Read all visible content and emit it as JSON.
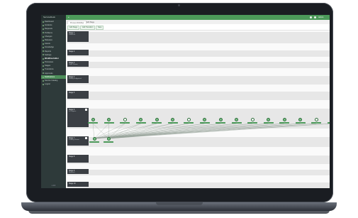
{
  "app": {
    "brand": "ServiceDesk",
    "footer": "v 1.0"
  },
  "sidebar": {
    "items": [
      {
        "label": "Dashboard"
      },
      {
        "label": "Incidents"
      },
      {
        "label": "Requests"
      },
      {
        "label": "Problems"
      },
      {
        "label": "Changes"
      },
      {
        "label": "Releases"
      },
      {
        "label": "Assets"
      },
      {
        "label": "Knowledge"
      },
      {
        "label": "Reports"
      },
      {
        "label": "Settings"
      },
      {
        "label": "Workflow Editor"
      },
      {
        "label": "Processes"
      },
      {
        "label": "Stages"
      },
      {
        "label": "Transitions"
      },
      {
        "label": "Approvals"
      },
      {
        "label": "Notifications"
      },
      {
        "label": "Service Catalog"
      },
      {
        "label": "Logout"
      }
    ],
    "active_index": 15
  },
  "topbar": {
    "left_text": "≡",
    "right_text": "Admin"
  },
  "tabs": [
    {
      "label": "Process Workflow"
    },
    {
      "label": "Edit Stage"
    }
  ],
  "toolbar": {
    "btn1": "Add Stage",
    "btn2": "Add Transition",
    "btn3": "Save"
  },
  "lanes": [
    {
      "title": "Stage 1",
      "sub": "Submitted"
    },
    {
      "title": "Stage 2",
      "sub": ""
    },
    {
      "title": "Stage 3",
      "sub": "Under Review"
    },
    {
      "title": "Stage 4",
      "sub": "Waiting for Approval"
    },
    {
      "title": "Stage 5",
      "sub": ""
    },
    {
      "title": "Stage 6",
      "sub": "In Progress"
    },
    {
      "title": "Stage 7",
      "sub": "Pending Closure"
    },
    {
      "title": "Stage 8",
      "sub": ""
    },
    {
      "title": "Stage 9",
      "sub": "Resolved"
    },
    {
      "title": "Stage 10",
      "sub": ""
    }
  ],
  "nodes_top": [
    {
      "label": "Step"
    },
    {
      "label": "Step"
    },
    {
      "label": "Step"
    },
    {
      "label": "Step"
    },
    {
      "label": "Step"
    },
    {
      "label": "Step"
    },
    {
      "label": "Step"
    },
    {
      "label": "Step"
    },
    {
      "label": "Step"
    },
    {
      "label": "Step"
    },
    {
      "label": "Step"
    },
    {
      "label": "Step"
    },
    {
      "label": "Step"
    },
    {
      "label": "Step"
    },
    {
      "label": "Step"
    },
    {
      "label": "Step"
    }
  ],
  "nodes_bottom": [
    {
      "label": "Start"
    },
    {
      "label": "Review"
    }
  ],
  "colors": {
    "accent": "#4c9a5a",
    "sidebar": "#2e3a3a",
    "lane": "#e7e7e7",
    "lane_label": "#3b3f44"
  }
}
